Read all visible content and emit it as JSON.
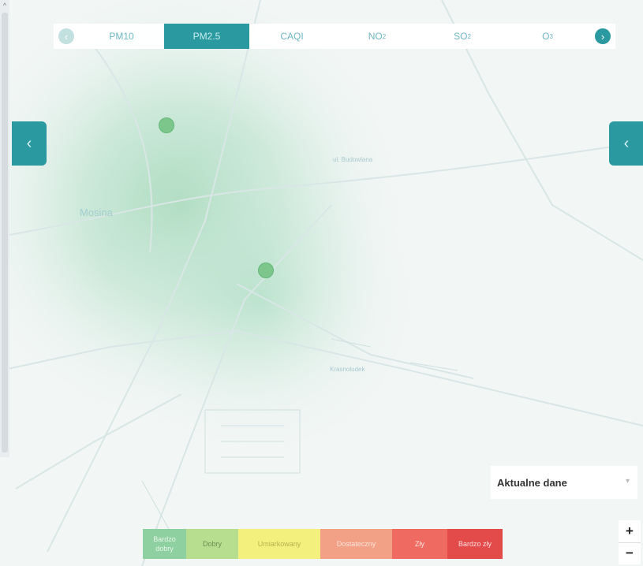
{
  "tabs": {
    "prev_icon": "chevron-left-icon",
    "next_icon": "chevron-right-icon",
    "items": [
      {
        "label": "PM10",
        "sub": ""
      },
      {
        "label": "PM2.5",
        "sub": ""
      },
      {
        "label": "CAQI",
        "sub": ""
      },
      {
        "label": "NO",
        "sub": "2"
      },
      {
        "label": "SO",
        "sub": "2"
      },
      {
        "label": "O",
        "sub": "3"
      }
    ],
    "active": "PM2.5"
  },
  "map": {
    "labels": {
      "town": "Mosina",
      "street_top": "ul. Budowlana",
      "street_mid": "Krasnoludek"
    },
    "stations": 2
  },
  "side_arrows": {
    "left_icon": "chevron-left-icon",
    "right_icon": "chevron-left-icon"
  },
  "dataset_select": {
    "value": "Aktualne dane",
    "icon": "chevron-down-icon"
  },
  "zoom": {
    "in": "+",
    "out": "−"
  },
  "legend": [
    {
      "label": "Bardzo dobry",
      "color": "#8fd0a0"
    },
    {
      "label": "Dobry",
      "color": "#b7dd8e"
    },
    {
      "label": "Umiarkowany",
      "color": "#f3f07e"
    },
    {
      "label": "Dostateczny",
      "color": "#f2a086"
    },
    {
      "label": "Zły",
      "color": "#ef6b62"
    },
    {
      "label": "Bardzo zły",
      "color": "#e34b4b"
    }
  ],
  "colors": {
    "accent": "#2a9aa0",
    "station": "#7cc68c"
  }
}
